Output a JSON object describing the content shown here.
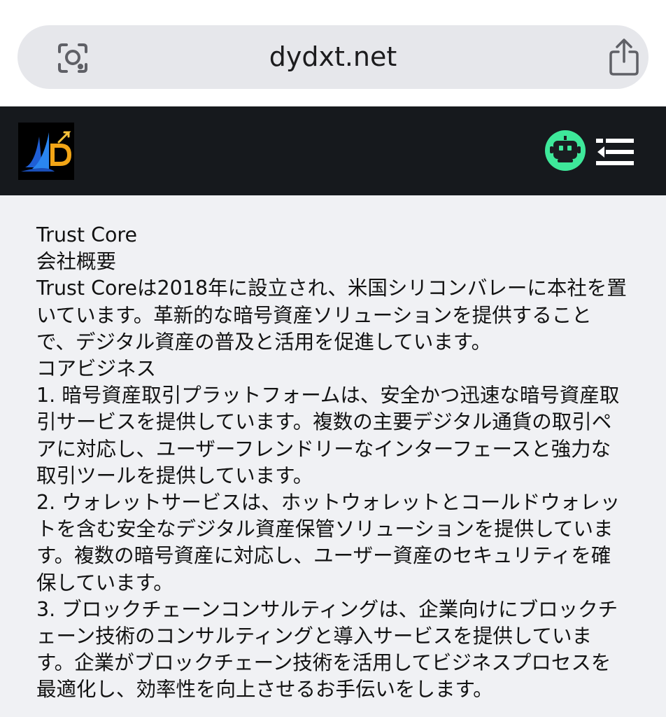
{
  "browser": {
    "url": "dydxt.net"
  },
  "icons": {
    "lens": "camera-lens-icon",
    "share": "share-icon",
    "bot": "bot-icon",
    "menu": "menu-icon"
  },
  "colors": {
    "header_bg": "#16191d",
    "bot_green": "#3ee89a",
    "content_bg": "#f0f1f4"
  },
  "content": {
    "site_name": "Trust Core",
    "about_heading": "会社概要",
    "about_text": "Trust Coreは2018年に設立され、米国シリコンバレーに本社を置いています。革新的な暗号資産ソリューションを提供することで、デジタル資産の普及と活用を促進しています。",
    "core_heading": "コアビジネス",
    "item1": "1. 暗号資産取引プラットフォームは、安全かつ迅速な暗号資産取引サービスを提供しています。複数の主要デジタル通貨の取引ペアに対応し、ユーザーフレンドリーなインターフェースと強力な取引ツールを提供しています。",
    "item2": "2. ウォレットサービスは、ホットウォレットとコールドウォレットを含む安全なデジタル資産保管ソリューションを提供しています。複数の暗号資産に対応し、ユーザー資産のセキュリティを確保しています。",
    "item3": "3. ブロックチェーンコンサルティングは、企業向けにブロックチェーン技術のコンサルティングと導入サービスを提供しています。企業がブロックチェーン技術を活用してビジネスプロセスを最適化し、効率性を向上させるお手伝いをします。"
  }
}
